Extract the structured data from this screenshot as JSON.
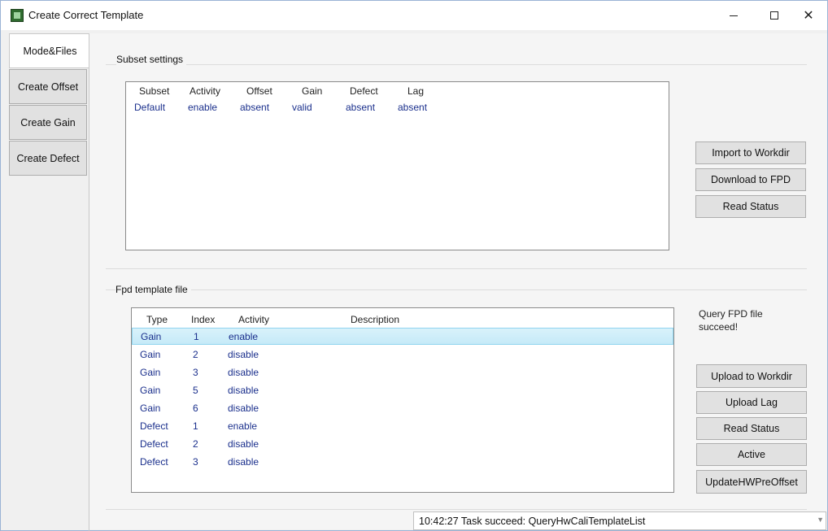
{
  "window": {
    "title": "Create Correct Template",
    "controls": [
      "minimize-icon",
      "maximize-icon",
      "close-icon"
    ]
  },
  "tabs": [
    {
      "label": "Mode&Files",
      "active": true
    },
    {
      "label": "Create Offset",
      "active": false
    },
    {
      "label": "Create Gain",
      "active": false
    },
    {
      "label": "Create Defect",
      "active": false
    }
  ],
  "subset": {
    "group_title": "Subset settings",
    "columns": [
      "Subset",
      "Activity",
      "Offset",
      "Gain",
      "Defect",
      "Lag"
    ],
    "rows": [
      [
        "Default",
        "enable",
        "absent",
        "valid",
        "absent",
        "absent"
      ]
    ],
    "buttons": {
      "import": "Import to Workdir",
      "download": "Download to FPD",
      "read_status": "Read Status"
    }
  },
  "fpd": {
    "group_title": "Fpd template file",
    "columns": [
      "Type",
      "Index",
      "Activity",
      "Description"
    ],
    "rows": [
      [
        "Gain",
        "1",
        "enable",
        ""
      ],
      [
        "Gain",
        "2",
        "disable",
        ""
      ],
      [
        "Gain",
        "3",
        "disable",
        ""
      ],
      [
        "Gain",
        "5",
        "disable",
        ""
      ],
      [
        "Gain",
        "6",
        "disable",
        ""
      ],
      [
        "Defect",
        "1",
        "enable",
        ""
      ],
      [
        "Defect",
        "2",
        "disable",
        ""
      ],
      [
        "Defect",
        "3",
        "disable",
        ""
      ]
    ],
    "selected_row": 0,
    "status_message": "Query FPD file succeed!",
    "buttons": {
      "upload_workdir": "Upload to Workdir",
      "upload_lag": "Upload Lag",
      "read_status": "Read Status",
      "active": "Active",
      "update_hw": "UpdateHWPreOffset"
    }
  },
  "statusbar": {
    "text": "10:42:27 Task succeed: QueryHwCaliTemplateList"
  }
}
